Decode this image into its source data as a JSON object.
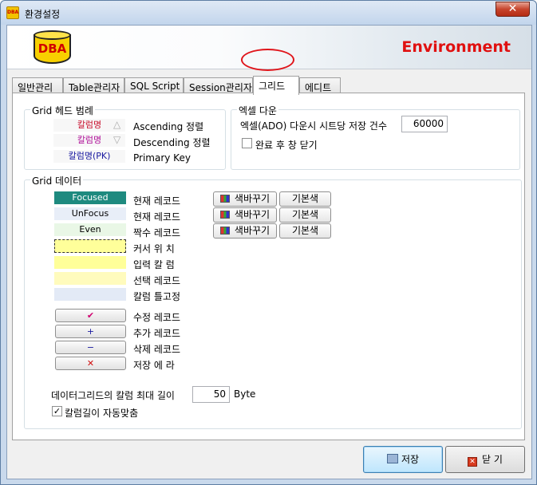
{
  "window": {
    "title": "환경설정",
    "app_icon_text": "DBA",
    "close_glyph": "✕"
  },
  "banner": {
    "logo_text": "DBA",
    "title": "Environment"
  },
  "tabs": [
    {
      "label": "일반관리"
    },
    {
      "label": "Table관리자"
    },
    {
      "label": "SQL Script"
    },
    {
      "label": "Session관리자"
    },
    {
      "label": "그리드"
    },
    {
      "label": "에디트"
    }
  ],
  "grid_header_legend": {
    "title": "Grid 헤드 범례",
    "rows": [
      {
        "sample": "칼럼명",
        "arrow": "△",
        "label": "Ascending 정렬"
      },
      {
        "sample": "칼럼명",
        "arrow": "▽",
        "label": "Descending 정렬"
      },
      {
        "sample": "칼럼명(PK)",
        "label": "Primary Key"
      }
    ]
  },
  "excel": {
    "title": "엑셀 다운",
    "rows_label": "엑셀(ADO) 다운시 시트당 저장 건수",
    "rows_value": "60000",
    "close_after_label": "완료 후 창 닫기",
    "close_after_checked": false
  },
  "grid_data": {
    "title": "Grid 데이터",
    "color_rows": [
      {
        "sample": "Focused",
        "label": "현재 레코드",
        "change_label": "색바꾸기",
        "default_label": "기본색"
      },
      {
        "sample": "UnFocus",
        "label": "현재 레코드",
        "change_label": "색바꾸기",
        "default_label": "기본색"
      },
      {
        "sample": "Even",
        "label": "짝수 레코드",
        "change_label": "색바꾸기",
        "default_label": "기본색"
      },
      {
        "sample": "",
        "label": "커서 위 치"
      },
      {
        "sample": "",
        "label": "입력 칼 럼"
      },
      {
        "sample": "",
        "label": "선택 레코드"
      },
      {
        "sample": "",
        "label": "칼럼 틀고정"
      }
    ],
    "marker_rows": [
      {
        "glyph": "✔",
        "label": "수정 레코드",
        "color": "#d0006f"
      },
      {
        "glyph": "+",
        "label": "추가 레코드",
        "color": "#1a1aa0"
      },
      {
        "glyph": "−",
        "label": "삭제 레코드",
        "color": "#1a1aa0"
      },
      {
        "glyph": "✕",
        "label": "저장 에 라",
        "color": "#d01010"
      }
    ],
    "max_width_label": "데이터그리드의 칼럼 최대 길이",
    "max_width_value": "50",
    "max_width_unit": "Byte",
    "auto_fit_label": "칼럼길이 자동맞춤",
    "auto_fit_checked": true
  },
  "footer": {
    "save_label": "저장",
    "close_label": "닫 기"
  },
  "colors": {
    "focused_bg": "#1e8a7f",
    "unfocus_bg": "#e8eef8",
    "even_bg": "#e9f7e6",
    "cursor_bg": "#ffff9a",
    "input_bg": "#ffff99",
    "selected_bg": "#fffbbd",
    "fixed_bg": "#e3eaf6",
    "highlight_ellipse": "#e0151b",
    "banner_title": "#e01010"
  }
}
